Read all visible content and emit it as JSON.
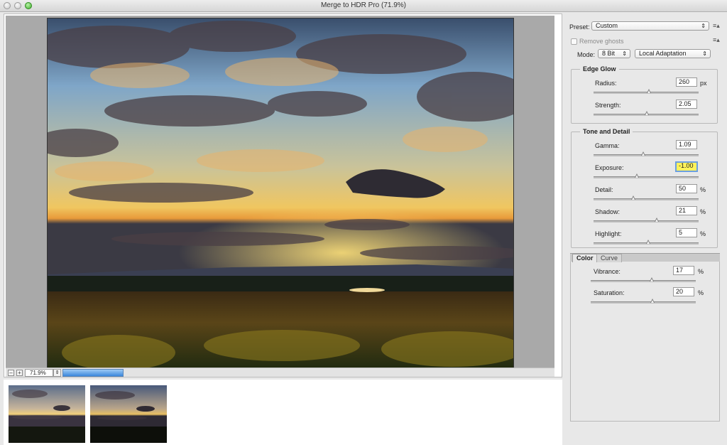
{
  "window": {
    "title": "Merge to HDR Pro (71.9%)"
  },
  "zoom": {
    "value": "71.9%",
    "progress_fraction": 0.5
  },
  "icons": {
    "zoom_out": "minus-icon",
    "zoom_in": "plus-icon",
    "stepper": "updown-icon",
    "panel_menu": "panel-menu-icon"
  },
  "preset": {
    "label": "Preset:",
    "value": "Custom"
  },
  "remove_ghosts": {
    "label": "Remove ghosts",
    "checked": false
  },
  "mode": {
    "label": "Mode:",
    "bit_depth": "8 Bit",
    "method": "Local Adaptation"
  },
  "edge_glow": {
    "title": "Edge Glow",
    "radius": {
      "label": "Radius:",
      "value": "260",
      "unit": "px",
      "slider": 0.53
    },
    "strength": {
      "label": "Strength:",
      "value": "2.05",
      "unit": "",
      "slider": 0.51
    }
  },
  "tone_detail": {
    "title": "Tone and Detail",
    "gamma": {
      "label": "Gamma:",
      "value": "1.09",
      "unit": "",
      "slider": 0.47
    },
    "exposure": {
      "label": "Exposure:",
      "value": "-1.00",
      "unit": "",
      "slider": 0.41
    },
    "detail": {
      "label": "Detail:",
      "value": "50",
      "unit": "%",
      "slider": 0.38
    },
    "shadow": {
      "label": "Shadow:",
      "value": "21",
      "unit": "%",
      "slider": 0.6
    },
    "highlight": {
      "label": "Highlight:",
      "value": "5",
      "unit": "%",
      "slider": 0.52
    }
  },
  "tabs": {
    "color": "Color",
    "curve": "Curve"
  },
  "color": {
    "vibrance": {
      "label": "Vibrance:",
      "value": "17",
      "unit": "%",
      "slider": 0.58
    },
    "saturation": {
      "label": "Saturation:",
      "value": "20",
      "unit": "%",
      "slider": 0.59
    }
  }
}
